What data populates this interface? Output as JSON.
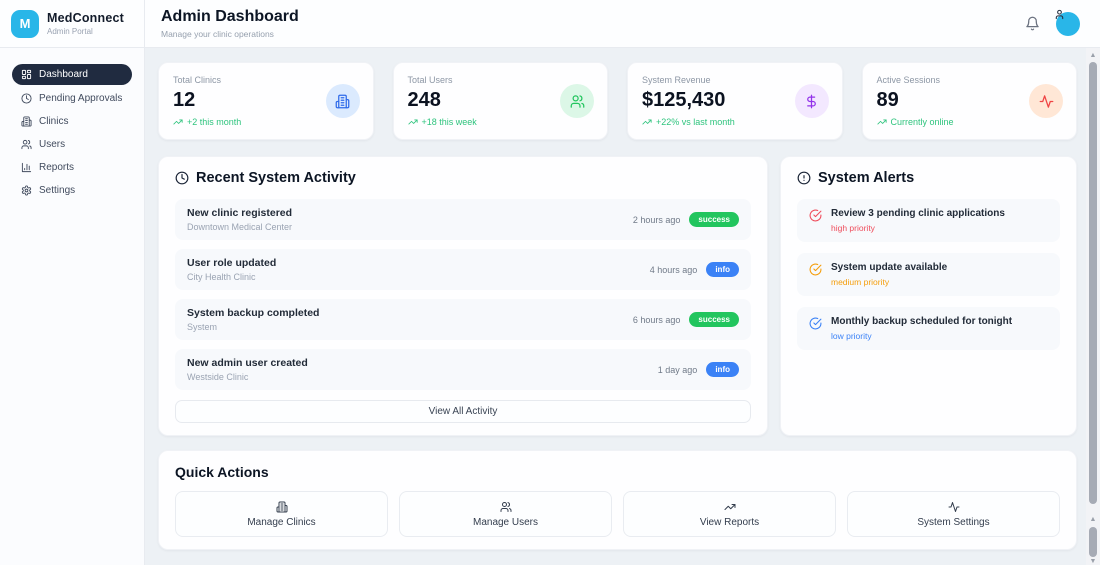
{
  "brand": {
    "logo_letter": "M",
    "name": "MedConnect",
    "subtitle": "Admin Portal",
    "accent_color": "#29b6e8"
  },
  "sidebar": {
    "items": [
      {
        "label": "Dashboard",
        "icon": "dashboard-icon",
        "active": true
      },
      {
        "label": "Pending Approvals",
        "icon": "clock-icon",
        "active": false
      },
      {
        "label": "Clinics",
        "icon": "building-icon",
        "active": false
      },
      {
        "label": "Users",
        "icon": "users-icon",
        "active": false
      },
      {
        "label": "Reports",
        "icon": "bar-chart-icon",
        "active": false
      },
      {
        "label": "Settings",
        "icon": "gear-icon",
        "active": false
      }
    ]
  },
  "header": {
    "title": "Admin Dashboard",
    "subtitle": "Manage your clinic operations",
    "icons": [
      "bell-icon",
      "user-avatar"
    ]
  },
  "stats": [
    {
      "label": "Total Clinics",
      "value": "12",
      "change": "+2 this month",
      "icon": "building-icon",
      "variant": "blue"
    },
    {
      "label": "Total Users",
      "value": "248",
      "change": "+18 this week",
      "icon": "users-icon",
      "variant": "green"
    },
    {
      "label": "System Revenue",
      "value": "$125,430",
      "change": "+22% vs last month",
      "icon": "dollar-sign-icon",
      "variant": "purple"
    },
    {
      "label": "Active Sessions",
      "value": "89",
      "change": "Currently online",
      "icon": "activity-icon",
      "variant": "orange"
    }
  ],
  "activity": {
    "title": "Recent System Activity",
    "title_icon": "clock-icon",
    "items": [
      {
        "title": "New clinic registered",
        "subtitle": "Downtown Medical Center",
        "time": "2 hours ago",
        "badge": "success"
      },
      {
        "title": "User role updated",
        "subtitle": "City Health Clinic",
        "time": "4 hours ago",
        "badge": "info"
      },
      {
        "title": "System backup completed",
        "subtitle": "System",
        "time": "6 hours ago",
        "badge": "success"
      },
      {
        "title": "New admin user created",
        "subtitle": "Westside Clinic",
        "time": "1 day ago",
        "badge": "info"
      }
    ],
    "view_all": "View All Activity"
  },
  "alerts": {
    "title": "System Alerts",
    "title_icon": "alert-circle-icon",
    "items": [
      {
        "text": "Review 3 pending clinic applications",
        "priority": "high priority",
        "level": "high",
        "icon": "check-circle-icon"
      },
      {
        "text": "System update available",
        "priority": "medium priority",
        "level": "medium",
        "icon": "check-circle-icon"
      },
      {
        "text": "Monthly backup scheduled for tonight",
        "priority": "low priority",
        "level": "low",
        "icon": "check-circle-icon"
      }
    ]
  },
  "quick_actions": {
    "title": "Quick Actions",
    "items": [
      {
        "label": "Manage Clinics",
        "icon": "building-icon"
      },
      {
        "label": "Manage Users",
        "icon": "users-icon"
      },
      {
        "label": "View Reports",
        "icon": "trending-up-icon"
      },
      {
        "label": "System Settings",
        "icon": "activity-icon"
      }
    ]
  },
  "colors": {
    "accent": "#29b6e8",
    "success": "#22c55e",
    "info": "#3b82f6",
    "warning": "#f59e0b",
    "danger": "#ef4444",
    "purple": "#9333ea",
    "positive_text": "#2fc47e"
  }
}
